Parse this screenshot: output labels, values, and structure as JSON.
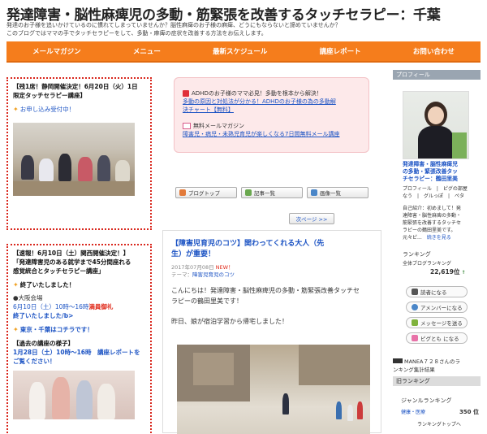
{
  "header": {
    "title": "発達障害・脳性麻痺児の多動・筋緊張を改善するタッチセラピー：千葉",
    "desc1": "発達のお子様を追いかけているのに慣れてしまっていませんか？脳性麻痺のお子様の麻痺、どうにもならないと諦めていませんか？",
    "desc2": "このブログではママの手でタッチセラピーをして、多動・麻痺の症状を改善する方法をお伝えします。"
  },
  "nav": [
    "メールマガジン",
    "メニュー",
    "最新スケジュール",
    "講座レポート",
    "お問い合わせ"
  ],
  "left1": {
    "line1": "【残1席！静岡開催決定！6月20日（火）1日",
    "line2": "限定タッチセラピー講座】",
    "apply": "お申し込み受付中！"
  },
  "left2": {
    "line1": "【速報！6月10日（土）関西開催決定！】",
    "line2": "「発達障害児のある就学まで45分間座れる",
    "line3": "感覚統合とタッチセラピー講座」",
    "finished": "終了いたしました！",
    "venue": "●大阪会場",
    "date_prefix": "6月10日（土）10時〜16時",
    "full": "満員御礼",
    "finished2": "終了いたしました/b>",
    "tokyo": "東京・千葉はコチラです！",
    "past_title": "【過去の講座の様子】",
    "past_line1": "1月28日（土）10時〜16時　講座レポートを",
    "past_line2": "ご覧ください！"
  },
  "pink": {
    "line1": "ADHDのお子様のママ必見！多動を根本から解決！",
    "link1a": "多動の原因と対処法が分かる！ADHDのお子様の為の多動解",
    "link1b": "決チャート【無料】",
    "line2": "無料メールマガジン",
    "link2": "障害児・病児・未熟児育児が楽しくなる7日間無料メール講座"
  },
  "buttons": {
    "top": "ブログトップ",
    "list": "記事一覧",
    "images": "画像一覧",
    "next": "次ページ >>"
  },
  "article": {
    "title1": "【障害児育児のコツ】関わってくれる大人（先",
    "title2": "生）が重要！",
    "date": "2017年07月08日",
    "new": "NEW！",
    "theme_label": "テーマ：",
    "theme": "障害児育児のコツ",
    "body1": "こんにちは！発達障害・脳性麻痺児の多動・筋緊張改善タッチセ",
    "body2": "ラピーの鶴田里美です！",
    "body3": "昨日、娘が宿泊学習から帰宅しました！"
  },
  "sidebar": {
    "profile_head": "プロフィール",
    "name1": "発達障害・脳性麻痺児",
    "name2": "の多動・緊張改善タッ",
    "name3": "チセラピー：鶴田里美",
    "links1": "プロフィール　|　ピグの部屋",
    "links2": "なう　|　グルっぽ　|　ペタ",
    "intro1": "自己紹介：初めまして！発",
    "intro2": "達障害・脳性麻痺の多動・",
    "intro3": "筋緊張を改善するタッチセ",
    "intro4": "ラピーの鶴田里美です。",
    "intro5": "元々ピ...",
    "more": "続きを見る",
    "ranking": "ランキング",
    "all_ranking": "全体ブログランキング",
    "rank_value": "22,619位",
    "reader": "読者になる",
    "ameba": "アメンバーになる",
    "message": "メッセージを送る",
    "pigg": "ピグとも になる",
    "manea1": "MANEA７２８さんのラ",
    "manea2": "ンキング集計結果",
    "old_ranking": "旧ランキング",
    "genre": "ジャンルランキング",
    "genre_item": "健康・医療",
    "genre_value": "350 位",
    "to_top": "ランキングトップへ"
  }
}
